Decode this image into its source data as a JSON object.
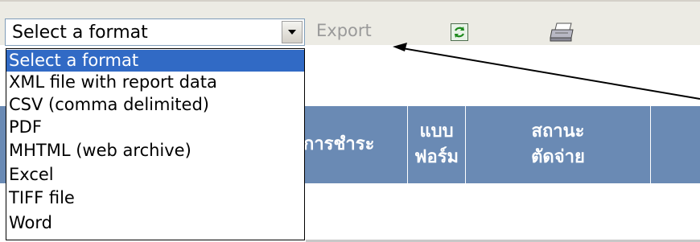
{
  "toolbar": {
    "select_value": "Select a format",
    "export_label": "Export",
    "refresh_icon": "refresh-icon",
    "print_icon": "printer-icon"
  },
  "dropdown": {
    "options": [
      "Select a format",
      "XML file with report data",
      "CSV (comma delimited)",
      "PDF",
      "MHTML (web archive)",
      "Excel",
      "TIFF file",
      "Word"
    ],
    "selected_index": 0
  },
  "table": {
    "headers": {
      "payment": "การชำระ",
      "form_line1": "แบบ",
      "form_line2": "ฟอร์ม",
      "status_line1": "สถานะ",
      "status_line2": "ตัดจ่าย"
    }
  },
  "colors": {
    "toolbar_bg": "#ecebe4",
    "header_bg": "#6a8ab4",
    "selection": "#316ac5",
    "export_disabled": "#9a9a9a"
  }
}
